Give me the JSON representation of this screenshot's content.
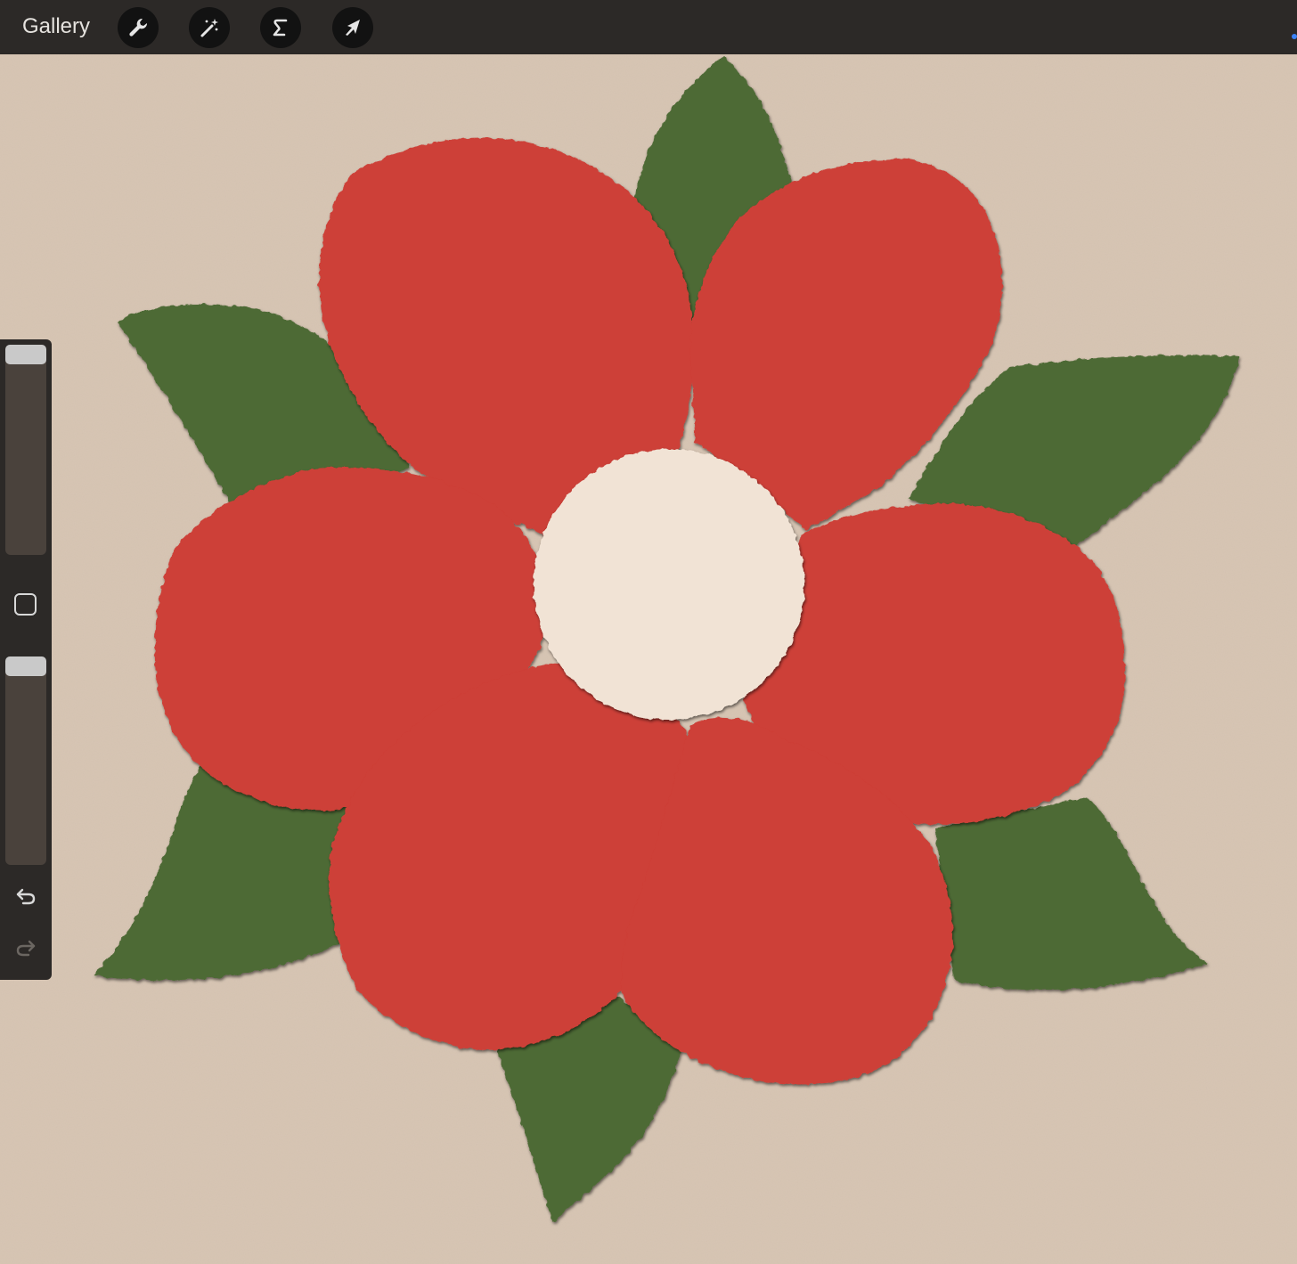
{
  "toolbar": {
    "gallery_label": "Gallery",
    "tools": [
      {
        "icon": "wrench-icon",
        "name": "actions"
      },
      {
        "icon": "magic-wand-icon",
        "name": "adjustments"
      },
      {
        "icon": "selection-s-icon",
        "name": "selection"
      },
      {
        "icon": "arrow-cursor-icon",
        "name": "transform"
      }
    ]
  },
  "sidebar": {
    "brush_size": 1.0,
    "opacity": 1.0,
    "undo_icon": "undo-icon",
    "redo_icon": "redo-icon"
  },
  "colors": {
    "background_paper": "#d7c6b5",
    "petal_red": "#cd3f37",
    "leaf_green": "#4e6a36",
    "center_cream": "#f1e3d5",
    "toolbar": "#2c2927"
  }
}
